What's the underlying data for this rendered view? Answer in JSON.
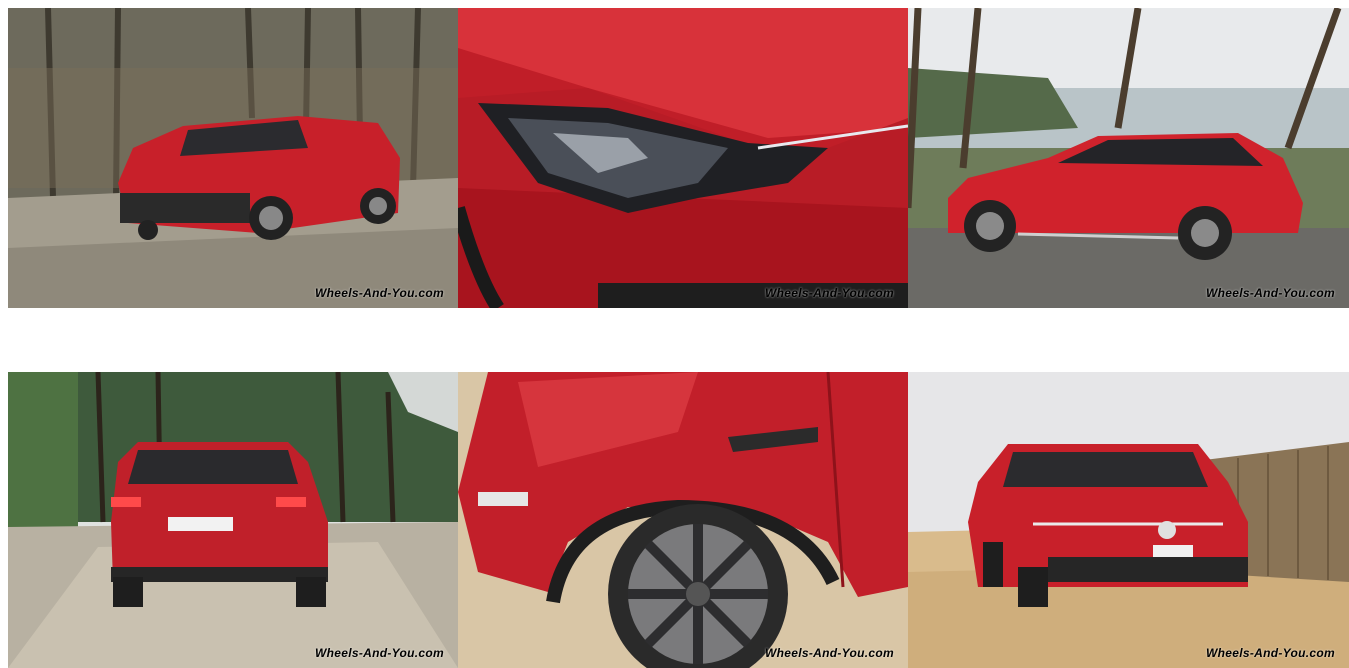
{
  "gallery": {
    "colors": {
      "car_red": "#c8202a",
      "watermark_red": "#d42a2a",
      "background": "#ffffff"
    },
    "photos": [
      {
        "subject": "red-wagon-front-three-quarter-forest",
        "watermark": "Wheels-And-You.com"
      },
      {
        "subject": "headlight-closeup",
        "watermark": "Wheels-And-You.com"
      },
      {
        "subject": "red-wagon-side-profile-coast",
        "watermark": "Wheels-And-You.com"
      },
      {
        "subject": "red-wagon-rear-forest-track",
        "watermark": "Wheels-And-You.com"
      },
      {
        "subject": "front-wheel-fender-closeup-sand",
        "watermark": "Wheels-And-You.com"
      },
      {
        "subject": "red-wagon-front-on-dune",
        "watermark": "Wheels-And-You.com"
      }
    ]
  }
}
